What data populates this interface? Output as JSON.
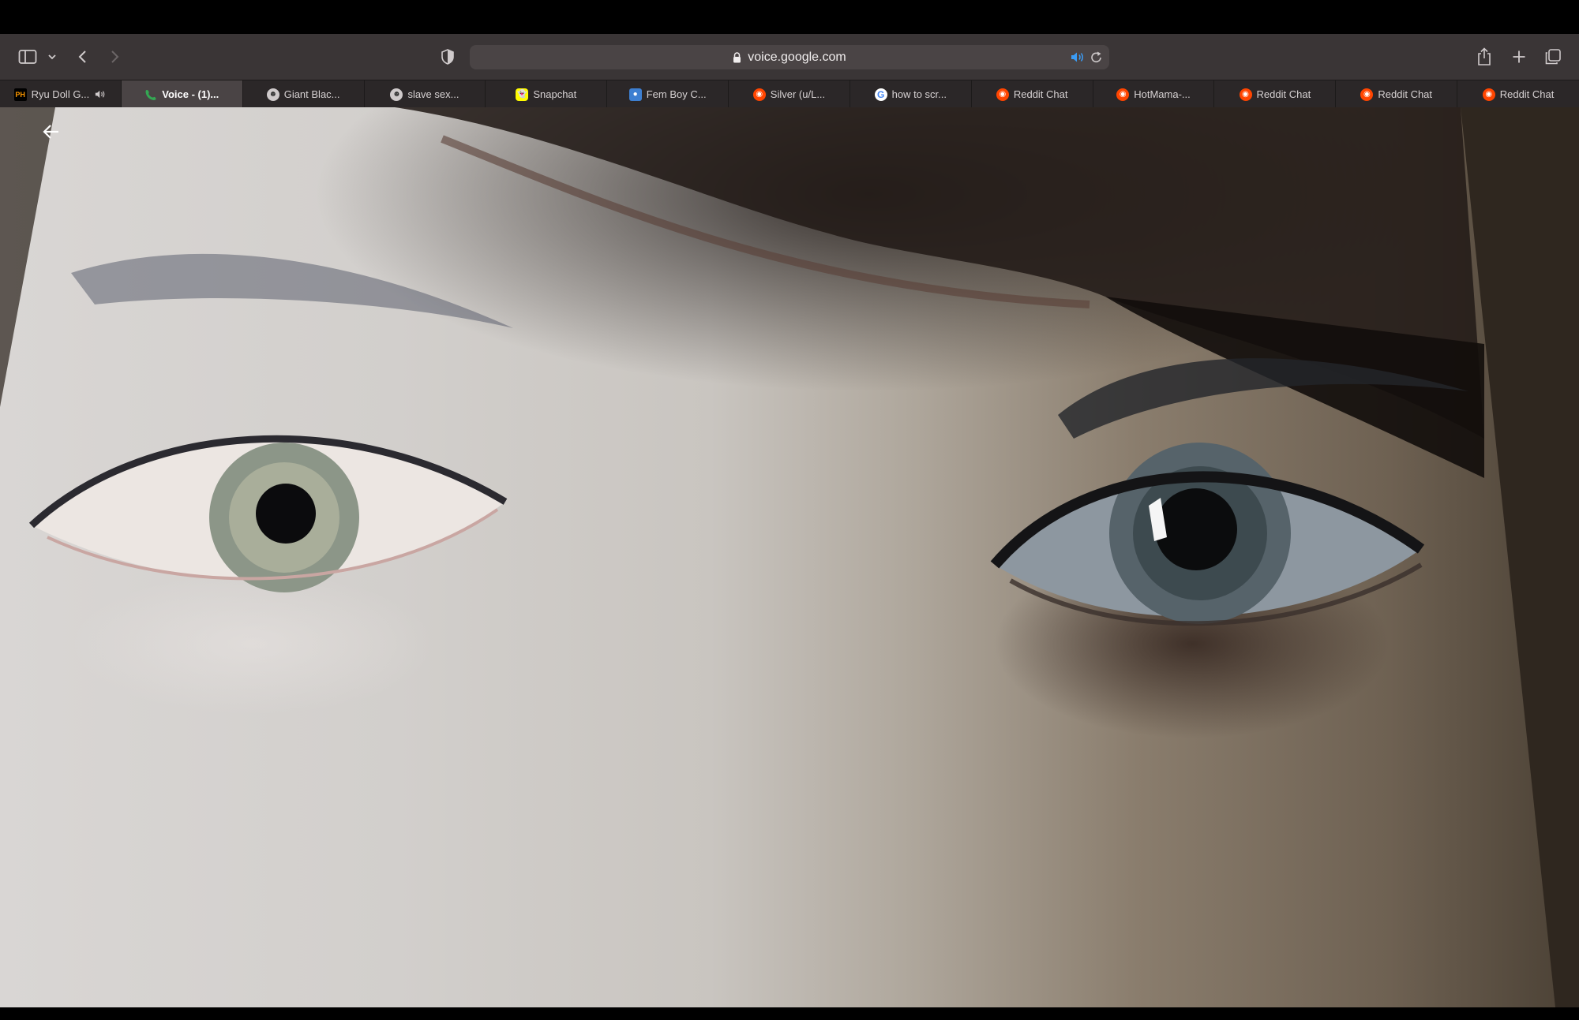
{
  "browser": {
    "address": "voice.google.com",
    "tabs": [
      {
        "label": "Ryu Doll G...",
        "icon": "pornhub-icon",
        "audio": true,
        "active": false
      },
      {
        "label": "Voice - (1)...",
        "icon": "google-voice-icon",
        "audio": false,
        "active": true
      },
      {
        "label": "Giant Blac...",
        "icon": "raccoon-icon",
        "audio": false,
        "active": false
      },
      {
        "label": "slave sex...",
        "icon": "raccoon-icon",
        "audio": false,
        "active": false
      },
      {
        "label": "Snapchat",
        "icon": "snapchat-icon",
        "audio": false,
        "active": false
      },
      {
        "label": "Fem Boy C...",
        "icon": "site-icon",
        "audio": false,
        "active": false
      },
      {
        "label": "Silver (u/L...",
        "icon": "reddit-icon",
        "audio": false,
        "active": false
      },
      {
        "label": "how to scr...",
        "icon": "google-icon",
        "audio": false,
        "active": false
      },
      {
        "label": "Reddit Chat",
        "icon": "reddit-icon",
        "audio": false,
        "active": false
      },
      {
        "label": "HotMama-...",
        "icon": "reddit-icon",
        "audio": false,
        "active": false
      },
      {
        "label": "Reddit Chat",
        "icon": "reddit-icon",
        "audio": false,
        "active": false
      },
      {
        "label": "Reddit Chat",
        "icon": "reddit-icon",
        "audio": false,
        "active": false
      },
      {
        "label": "Reddit Chat",
        "icon": "reddit-icon",
        "audio": false,
        "active": false
      }
    ]
  },
  "colors": {
    "toolbar": "#3a3536",
    "tabbar": "#2b2728",
    "reddit": "#ff4500",
    "snapchat": "#fffc00",
    "audio_accent": "#3b9cf5"
  }
}
